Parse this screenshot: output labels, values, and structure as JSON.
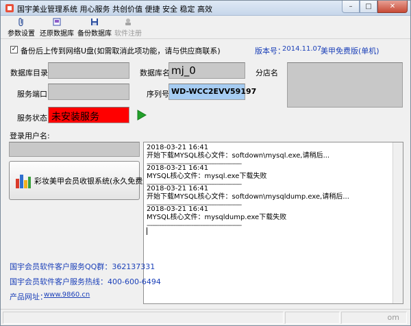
{
  "window": {
    "title": "国宇美业管理系统  用心服务  共创价值  便捷 安全 稳定 高效",
    "minimize": "–",
    "maximize": "□",
    "close": "✕"
  },
  "toolbar": [
    {
      "label": "参数设置",
      "icon": "paperclip-icon"
    },
    {
      "label": "还原数据库",
      "icon": "restore-icon"
    },
    {
      "label": "备份数据库",
      "icon": "save-icon"
    },
    {
      "label": "软件注册",
      "icon": "register-icon"
    }
  ],
  "backup": {
    "checked": "✓",
    "label": "备份后上传到网络U盘(如需取消此项功能，请与供应商联系)"
  },
  "version": {
    "label": "版本号：",
    "value": "2014.11.07",
    "edition": "美甲免费版(单机)"
  },
  "form": {
    "db_dir_label": "数据库目录",
    "db_dir_value": "",
    "db_name_label": "数据库名",
    "db_name_value": "mj_0",
    "branch_label": "分店名",
    "branch_value": "",
    "port_label": "服务端口",
    "port_value": "",
    "serial_label": "序列号",
    "serial_value": "WD-WCC2EVV59197",
    "status_label": "服务状态",
    "status_value": "未安装服务"
  },
  "login": {
    "label": "登录用户名:",
    "value": ""
  },
  "main_button": {
    "label": "彩妆美甲会员收银系统(永久免费版)",
    "icon": "bar-chart-icon"
  },
  "log": [
    {
      "time": "2018-03-21 16:41",
      "msg": "开始下载MYSQL核心文件：softdown\\mysql.exe,请稍后...",
      "sep": "-----------------------------------------------------"
    },
    {
      "time": "2018-03-21 16:41",
      "msg": "MYSQL核心文件：mysql.exe下载失败",
      "sep": "-----------------------------------------------------"
    },
    {
      "time": "2018-03-21 16:41",
      "msg": "开始下载MYSQL核心文件：softdown\\mysqldump.exe,请稍后...",
      "sep": "-----------------------------------------------------"
    },
    {
      "time": "2018-03-21 16:41",
      "msg": "MYSQL核心文件：mysqldump.exe下载失败",
      "sep": "-----------------------------------------------------"
    }
  ],
  "contact": {
    "qq": "国宇会员软件客户服务QQ群：362137331",
    "hotline": "国宇会员软件客户服务热线：400-600-6494",
    "site_label": "产品网址：",
    "site_url": "www.9860.cn"
  },
  "status_bar": {
    "right_text": "om"
  },
  "colors": {
    "status_red": "#ff0000",
    "serial_blue": "#a6ccf2",
    "link_blue": "#1a3fb8"
  }
}
